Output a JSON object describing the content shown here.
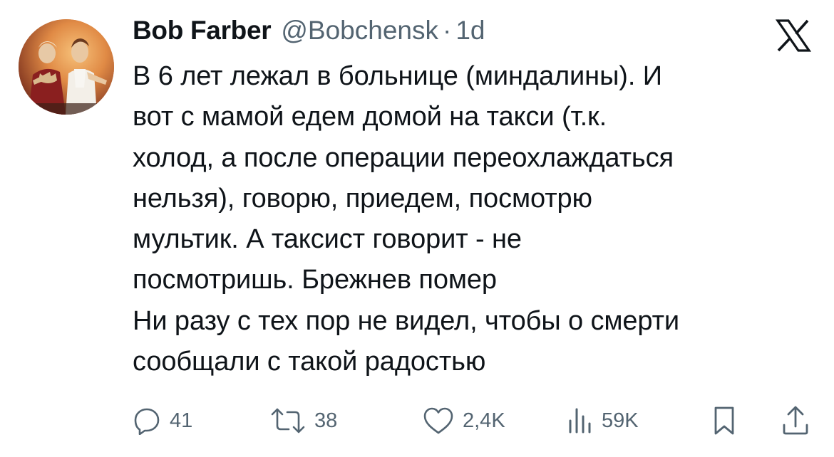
{
  "author": {
    "display_name": "Bob Farber",
    "handle": "@Bobchensk",
    "separator": "·",
    "time": "1d"
  },
  "tweet": {
    "text": "В 6 лет лежал в больнице (миндалины). И\nвот с мамой едем домой на такси (т.к.\nхолод, а после операции переохлаждаться\nнельзя), говорю, приедем, посмотрю\nмультик. А таксист говорит - не\nпосмотришь. Брежнев помер\nНи разу с тех пор не видел, чтобы о смерти\nсообщали с такой радостью"
  },
  "actions": {
    "replies": "41",
    "reposts": "38",
    "likes": "2,4K",
    "views": "59K"
  },
  "icons": {
    "platform": "x-logo-icon",
    "reply": "reply-icon",
    "repost": "repost-icon",
    "like": "heart-icon",
    "views": "views-icon",
    "bookmark": "bookmark-icon",
    "share": "share-icon"
  },
  "colors": {
    "text": "#0f1419",
    "secondary": "#536471"
  }
}
